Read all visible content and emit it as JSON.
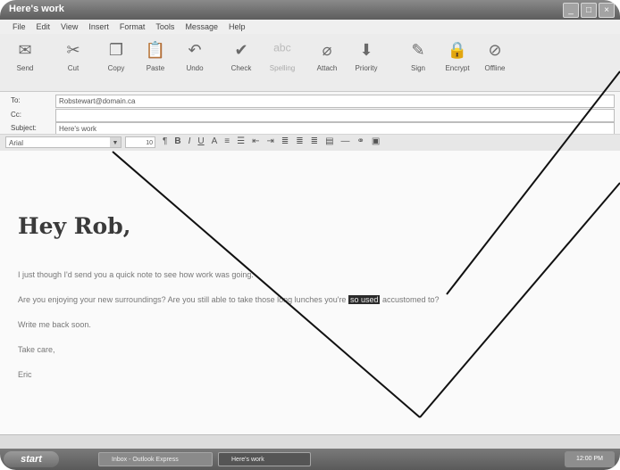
{
  "window": {
    "title": "Here's work",
    "controls": {
      "minimize": "_",
      "maximize": "□",
      "close": "×"
    }
  },
  "menu": [
    "File",
    "Edit",
    "View",
    "Insert",
    "Format",
    "Tools",
    "Message",
    "Help"
  ],
  "toolbar": [
    {
      "label": "Send",
      "icon": "send-icon",
      "glyph": "✉",
      "enabled": true
    },
    {
      "label": "Cut",
      "icon": "cut-icon",
      "glyph": "✂",
      "enabled": true
    },
    {
      "label": "Copy",
      "icon": "copy-icon",
      "glyph": "❐",
      "enabled": true
    },
    {
      "label": "Paste",
      "icon": "paste-icon",
      "glyph": "📋",
      "enabled": true
    },
    {
      "label": "Undo",
      "icon": "undo-icon",
      "glyph": "↶",
      "enabled": true
    },
    {
      "label": "Check",
      "icon": "check-names-icon",
      "glyph": "✔",
      "enabled": true
    },
    {
      "label": "Spelling",
      "icon": "spelling-icon",
      "glyph": "ᵃᵇᶜ",
      "enabled": false
    },
    {
      "label": "Attach",
      "icon": "attach-icon",
      "glyph": "⌀",
      "enabled": true
    },
    {
      "label": "Priority",
      "icon": "priority-icon",
      "glyph": "⬇",
      "enabled": true
    },
    {
      "label": "Sign",
      "icon": "sign-icon",
      "glyph": "✎",
      "enabled": true
    },
    {
      "label": "Encrypt",
      "icon": "encrypt-icon",
      "glyph": "🔒",
      "enabled": true
    },
    {
      "label": "Offline",
      "icon": "offline-icon",
      "glyph": "⊘",
      "enabled": true
    }
  ],
  "fields": {
    "to_label": "To:",
    "to_value": "Robstewart@domain.ca",
    "cc_label": "Cc:",
    "cc_value": "",
    "subject_label": "Subject:",
    "subject_value": "Here's work"
  },
  "format": {
    "font": "Arial",
    "size": "10"
  },
  "message": {
    "greeting": "Hey Rob,",
    "line1": "I just though I'd send you a quick note to see how work was going.",
    "line2_before": "Are you enjoying your new surroundings?  Are you still able to take those long lunches you're ",
    "line2_highlight": "so used",
    "line2_after": " accustomed to?",
    "line3": "Write me back soon.",
    "line4": "Take care,",
    "line5": "Eric"
  },
  "taskbar": {
    "start": "start",
    "tasks": [
      "Inbox - Outlook Express",
      "Here's work"
    ],
    "clock": "12:00 PM"
  }
}
